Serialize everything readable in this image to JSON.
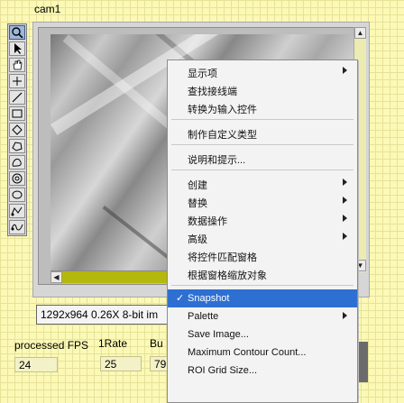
{
  "window": {
    "title": "cam1"
  },
  "palette": {
    "tools": [
      {
        "name": "zoom-tool",
        "icon": "magnifier-icon",
        "selected": true
      },
      {
        "name": "select-tool",
        "icon": "arrow-cursor-icon",
        "selected": false
      },
      {
        "name": "pan-tool",
        "icon": "hand-icon",
        "selected": false
      },
      {
        "name": "point-tool",
        "icon": "crosshair-icon",
        "selected": false
      },
      {
        "name": "line-tool",
        "icon": "line-icon",
        "selected": false
      },
      {
        "name": "rectangle-tool",
        "icon": "rectangle-icon",
        "selected": false
      },
      {
        "name": "rotated-rectangle-tool",
        "icon": "diamond-icon",
        "selected": false
      },
      {
        "name": "polygon-tool",
        "icon": "polygon-icon",
        "selected": false
      },
      {
        "name": "freehand-tool",
        "icon": "freehand-icon",
        "selected": false
      },
      {
        "name": "annulus-tool",
        "icon": "annulus-icon",
        "selected": false
      },
      {
        "name": "oval-tool",
        "icon": "oval-icon",
        "selected": false
      },
      {
        "name": "broken-line-tool",
        "icon": "broken-line-icon",
        "selected": false
      },
      {
        "name": "freehand-line-tool",
        "icon": "freehand-line-icon",
        "selected": false
      }
    ]
  },
  "image_display": {
    "info": "1292x964 0.26X 8-bit im",
    "scroll_up_glyph": "▲",
    "scroll_down_glyph": "▼",
    "scroll_left_glyph": "◀"
  },
  "stats": {
    "fps_label": "processed FPS",
    "fps_value": "24",
    "rate_label": "1Rate",
    "rate_value": "25",
    "buf_label": "Bu",
    "buf_value": "79"
  },
  "context_menu": {
    "groups": [
      [
        {
          "label": "显示项",
          "submenu": true
        },
        {
          "label": "查找接线端",
          "submenu": false
        },
        {
          "label": "转换为输入控件",
          "submenu": false
        }
      ],
      [
        {
          "label": "制作自定义类型",
          "submenu": false
        }
      ],
      [
        {
          "label": "说明和提示...",
          "submenu": false
        }
      ],
      [
        {
          "label": "创建",
          "submenu": true
        },
        {
          "label": "替换",
          "submenu": true
        },
        {
          "label": "数据操作",
          "submenu": true
        },
        {
          "label": "高级",
          "submenu": true
        },
        {
          "label": "将控件匹配窗格",
          "submenu": false
        },
        {
          "label": "根据窗格缩放对象",
          "submenu": false
        }
      ],
      [
        {
          "label": "Snapshot",
          "submenu": false,
          "checked": true,
          "highlighted": true
        },
        {
          "label": "Palette",
          "submenu": true
        },
        {
          "label": "Save Image...",
          "submenu": false
        },
        {
          "label": "Maximum Contour Count...",
          "submenu": false
        },
        {
          "label": "ROI Grid Size...",
          "submenu": false
        }
      ]
    ],
    "check_glyph": "✓"
  },
  "colors": {
    "background": "#fbf9b5",
    "menu_highlight": "#2e70d1",
    "scrollbar": "#b4b80c"
  }
}
